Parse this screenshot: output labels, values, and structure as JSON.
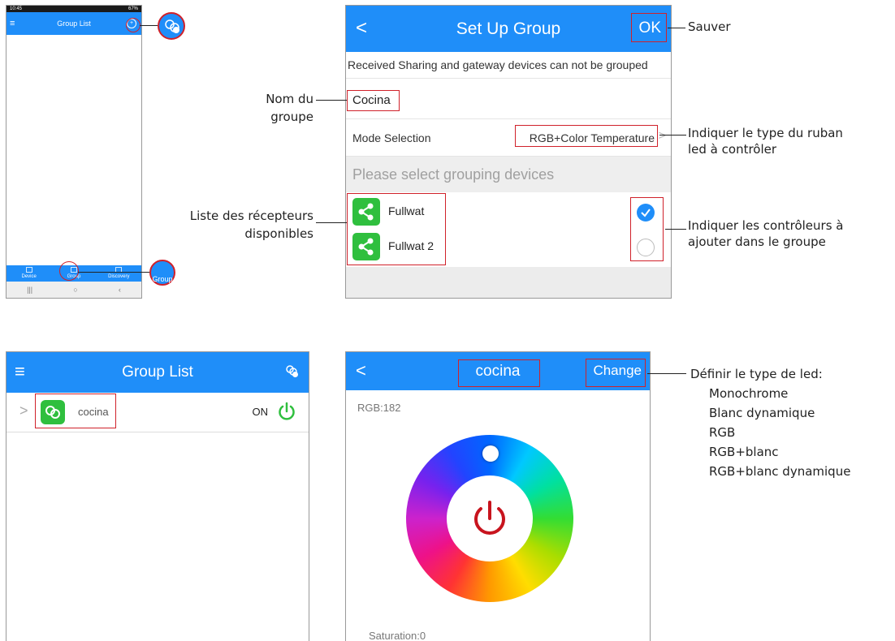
{
  "colors": {
    "brand_blue": "#1f8ef9",
    "highlight_red": "#d0212a",
    "device_green": "#2fbf3e",
    "power_on_green": "#2fbf3e",
    "power_red": "#c8141e"
  },
  "phone1": {
    "status_time": "10:45",
    "status_right": "67%",
    "title": "Group List",
    "nav": [
      "Device",
      "Group",
      "Discovery"
    ],
    "sys_keys": [
      "|||",
      "○",
      "‹"
    ],
    "group_badge": "Group"
  },
  "setup": {
    "title": "Set Up Group",
    "ok_label": "OK",
    "warning": "Received Sharing and gateway devices can not be grouped",
    "group_name": "Cocina",
    "mode_label": "Mode Selection",
    "mode_value": "RGB+Color Temperature",
    "hint": "Please select grouping devices",
    "devices": [
      {
        "name": "Fullwat",
        "selected": true
      },
      {
        "name": "Fullwat 2",
        "selected": false
      }
    ]
  },
  "grouplist": {
    "title": "Group List",
    "group_name": "cocina",
    "state": "ON"
  },
  "control": {
    "title": "cocina",
    "change_label": "Change",
    "rgb_readout": "RGB:182",
    "saturation_readout": "Saturation:0"
  },
  "callouts": {
    "save": "Sauver",
    "group_name_1": "Nom du",
    "group_name_2": "groupe",
    "strip_type_1": "Indiquer le type du ruban",
    "strip_type_2": "led à contrôler",
    "receivers_1": "Liste des récepteurs",
    "receivers_2": "disponibles",
    "controllers_1": "Indiquer les contrôleurs à",
    "controllers_2": "ajouter dans le groupe",
    "led_type_title": "Définir le type de led:",
    "led_types": [
      "Monochrome",
      "Blanc dynamique",
      "RGB",
      "RGB+blanc",
      "RGB+blanc dynamique"
    ]
  }
}
